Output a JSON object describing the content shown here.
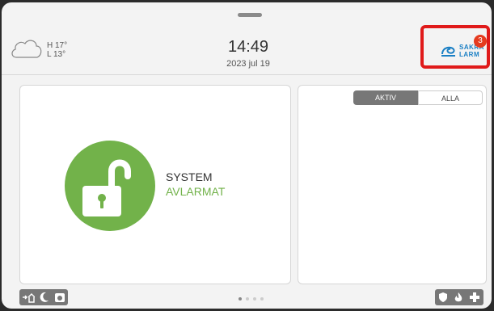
{
  "weather": {
    "high": "H 17°",
    "low": "L 13°",
    "icon": "cloud-icon"
  },
  "clock": {
    "time": "14:49",
    "date": "2023 jul 19"
  },
  "logo": {
    "line1": "SAKRA",
    "line2": "LARM",
    "notification_count": "3"
  },
  "system_status": {
    "line1": "SYSTEM",
    "line2": "AVLARMAT",
    "icon": "unlocked-padlock-icon"
  },
  "events": {
    "tabs": [
      {
        "label": "AKTIV",
        "active": true
      },
      {
        "label": "ALLA",
        "active": false
      }
    ]
  },
  "pager": {
    "pages": 4,
    "current": 1
  },
  "quick_actions": {
    "left": [
      "arm-away-icon",
      "arm-night-icon",
      "arm-stay-icon"
    ],
    "right": [
      "shield-icon",
      "fire-icon",
      "medical-cross-icon"
    ]
  },
  "colors": {
    "accent_green": "#72b24a",
    "badge_red": "#e53b1f",
    "highlight_red": "#e01a1a",
    "logo_blue": "#1a7fc4"
  }
}
